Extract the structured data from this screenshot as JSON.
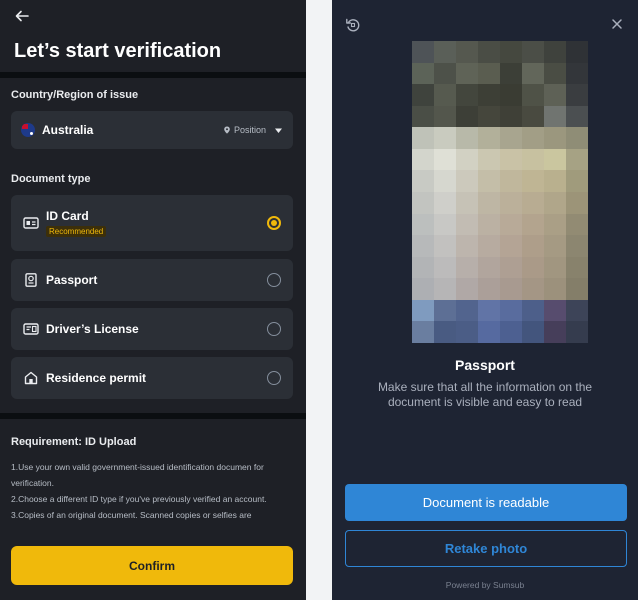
{
  "left": {
    "title": "Let’s start verification",
    "country_section_label": "Country/Region of issue",
    "country": {
      "name": "Australia",
      "flag": "australia-flag",
      "position_label": "Position"
    },
    "document_type_label": "Document type",
    "document_options": [
      {
        "label": "ID Card",
        "badge": "Recommended",
        "icon": "id-card-icon",
        "selected": true
      },
      {
        "label": "Passport",
        "icon": "passport-icon",
        "selected": false
      },
      {
        "label": "Driver’s License",
        "icon": "drivers-license-icon",
        "selected": false
      },
      {
        "label": "Residence permit",
        "icon": "residence-permit-icon",
        "selected": false
      }
    ],
    "requirement": {
      "title": "Requirement: ID Upload",
      "lines": [
        "1.Use your own valid government-issued identification documen for verification.",
        "2.Choose a different ID type if you've previously verified an account.",
        "3.Copies of an original document. Scanned copies or selfies are"
      ]
    },
    "confirm_label": "Confirm"
  },
  "right": {
    "document_name": "Passport",
    "hint": "Make sure that all the information on the document is visible and easy to read",
    "readable_label": "Document is readable",
    "retake_label": "Retake photo",
    "powered_by": "Powered by Sumsub"
  },
  "colors": {
    "accent_yellow": "#f0b90b",
    "left_bg": "#1e2026",
    "card_bg": "#2b2f36",
    "right_bg": "#1e2433",
    "accent_blue": "#2f86d6"
  }
}
